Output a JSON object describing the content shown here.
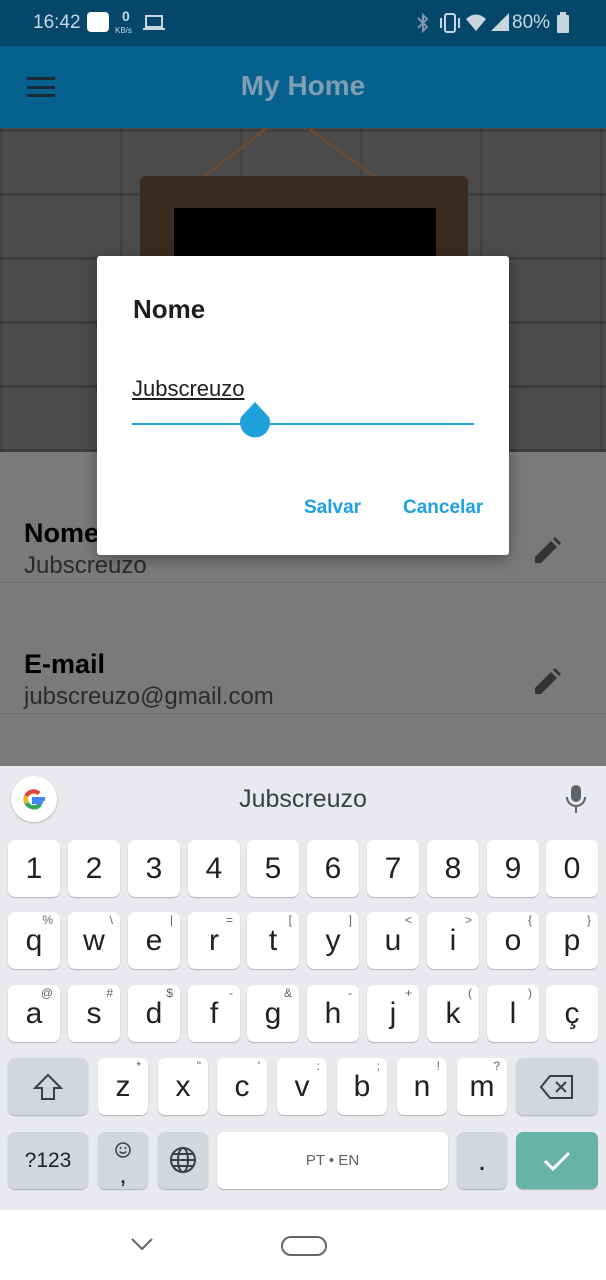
{
  "status_bar": {
    "time": "16:42",
    "data_rate_value": "0",
    "data_rate_unit": "KB/s",
    "battery": "80%"
  },
  "app_bar": {
    "title": "My Home"
  },
  "profile": {
    "rows": [
      {
        "label": "Nome",
        "value": "Jubscreuzo"
      },
      {
        "label": "E-mail",
        "value": "jubscreuzo@gmail.com"
      }
    ]
  },
  "dialog": {
    "title": "Nome",
    "input_value": "Jubscreuzo",
    "save_label": "Salvar",
    "cancel_label": "Cancelar",
    "accent": "#1ea1dc"
  },
  "keyboard": {
    "suggestion": "Jubscreuzo",
    "row1": [
      "1",
      "2",
      "3",
      "4",
      "5",
      "6",
      "7",
      "8",
      "9",
      "0"
    ],
    "row2": [
      {
        "k": "q",
        "h": "%"
      },
      {
        "k": "w",
        "h": "\\"
      },
      {
        "k": "e",
        "h": "|"
      },
      {
        "k": "r",
        "h": "="
      },
      {
        "k": "t",
        "h": "["
      },
      {
        "k": "y",
        "h": "]"
      },
      {
        "k": "u",
        "h": "<"
      },
      {
        "k": "i",
        "h": ">"
      },
      {
        "k": "o",
        "h": "{"
      },
      {
        "k": "p",
        "h": "}"
      }
    ],
    "row3": [
      {
        "k": "a",
        "h": "@"
      },
      {
        "k": "s",
        "h": "#"
      },
      {
        "k": "d",
        "h": "$"
      },
      {
        "k": "f",
        "h": "-"
      },
      {
        "k": "g",
        "h": "&"
      },
      {
        "k": "h",
        "h": "-"
      },
      {
        "k": "j",
        "h": "+"
      },
      {
        "k": "k",
        "h": "("
      },
      {
        "k": "l",
        "h": ")"
      },
      {
        "k": "ç",
        "h": ""
      }
    ],
    "row4": [
      {
        "k": "z",
        "h": "*"
      },
      {
        "k": "x",
        "h": "\""
      },
      {
        "k": "c",
        "h": "'"
      },
      {
        "k": "v",
        "h": ":"
      },
      {
        "k": "b",
        "h": ";"
      },
      {
        "k": "n",
        "h": "!"
      },
      {
        "k": "m",
        "h": "?"
      }
    ],
    "symbols_label": "?123",
    "emoji_sub": ",",
    "space_label": "PT • EN",
    "period_label": ".",
    "enter_color": "#67b3a6"
  }
}
